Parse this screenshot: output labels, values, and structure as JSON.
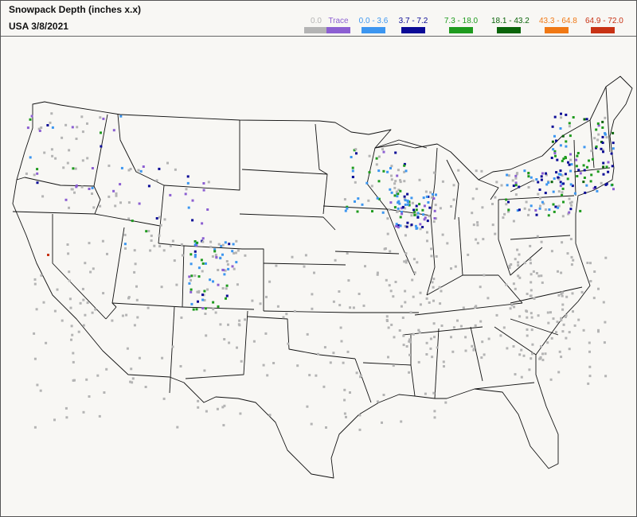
{
  "header": {
    "title": "Snowpack Depth (inches  x.x)",
    "subtitle": "USA 3/8/2021"
  },
  "legend": [
    {
      "label": "0.0",
      "color": "#b4b4b4"
    },
    {
      "label": "Trace",
      "color": "#8c5fd2"
    },
    {
      "label": "0.0 - 3.6",
      "color": "#3c96f0"
    },
    {
      "label": "3.7 - 7.2",
      "color": "#0a0a96"
    },
    {
      "label": "7.3 - 18.0",
      "color": "#1e9b1e"
    },
    {
      "label": "18.1 - 43.2",
      "color": "#0a640a"
    },
    {
      "label": "43.3 - 64.8",
      "color": "#f07814"
    },
    {
      "label": "64.9 - 72.0",
      "color": "#c83214"
    }
  ],
  "map": {
    "land_color": "#f8f7f4",
    "border_color": "#111111"
  }
}
